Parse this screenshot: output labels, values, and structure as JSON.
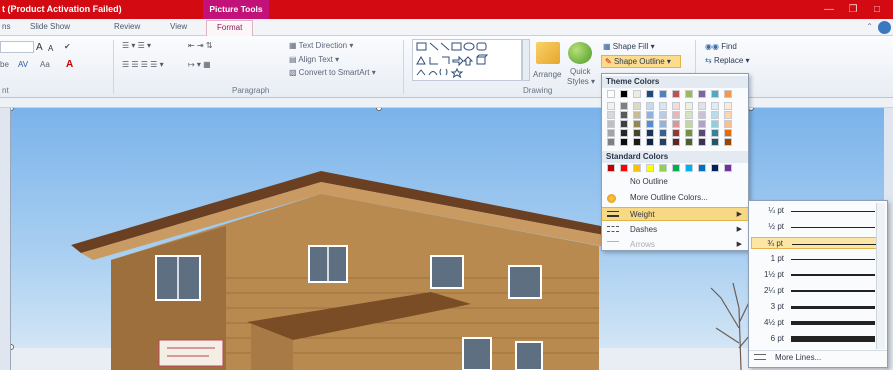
{
  "window": {
    "title": "t (Product Activation Failed)",
    "contextual_tab_group": "Picture Tools",
    "minimize_icon": "minimize-icon",
    "restore_icon": "restore-icon"
  },
  "tabs": [
    {
      "label": "ns"
    },
    {
      "label": "Slide Show"
    },
    {
      "label": "Review"
    },
    {
      "label": "View"
    },
    {
      "label": "Format"
    }
  ],
  "ribbon": {
    "font": {
      "label": "nt",
      "size_prefix": "be",
      "grow_icon": "A",
      "shrink_icon": "A",
      "clear_icon": "A",
      "char_spacing": "AV",
      "change_case": "Aa",
      "font_color": "A"
    },
    "paragraph": {
      "label": "Paragraph",
      "text_direction": "Text Direction",
      "align_text": "Align Text",
      "convert_smartart": "Convert to SmartArt"
    },
    "drawing": {
      "label": "Drawing",
      "arrange": "Arrange",
      "quick_styles_line1": "Quick",
      "quick_styles_line2": "Styles",
      "shape_fill": "Shape Fill",
      "shape_outline": "Shape Outline"
    },
    "editing": {
      "find": "Find",
      "replace": "Replace"
    }
  },
  "outline_menu": {
    "theme_colors_header": "Theme Colors",
    "standard_colors_header": "Standard Colors",
    "theme_top_row": [
      "#ffffff",
      "#000000",
      "#eeece1",
      "#1f497d",
      "#4f81bd",
      "#c0504d",
      "#9bbb59",
      "#8064a2",
      "#4bacc6",
      "#f79646"
    ],
    "theme_shades": [
      [
        "#f2f2f2",
        "#7f7f7f",
        "#ddd9c3",
        "#c6d9f0",
        "#dbe5f1",
        "#f2dcdb",
        "#ebf1dd",
        "#e5e0ec",
        "#dbeef3",
        "#fdeada"
      ],
      [
        "#d8d8d8",
        "#595959",
        "#c4bd97",
        "#8db3e2",
        "#b8cce4",
        "#e5b9b7",
        "#d7e3bc",
        "#ccc1d9",
        "#b7dde8",
        "#fbd5b5"
      ],
      [
        "#bfbfbf",
        "#3f3f3f",
        "#938953",
        "#548dd4",
        "#95b3d7",
        "#d99694",
        "#c3d69b",
        "#b2a2c7",
        "#92cddc",
        "#fac08f"
      ],
      [
        "#a5a5a5",
        "#262626",
        "#494429",
        "#17365d",
        "#366092",
        "#953734",
        "#76923c",
        "#5f497a",
        "#31859b",
        "#e36c09"
      ],
      [
        "#7f7f7f",
        "#0c0c0c",
        "#1d1b10",
        "#0f243e",
        "#244061",
        "#632423",
        "#4f6128",
        "#3f3151",
        "#205867",
        "#974806"
      ]
    ],
    "standard_colors": [
      "#c00000",
      "#ff0000",
      "#ffc000",
      "#ffff00",
      "#92d050",
      "#00b050",
      "#00b0f0",
      "#0070c0",
      "#002060",
      "#7030a0"
    ],
    "items": {
      "no_outline": "No Outline",
      "more_colors": "More Outline Colors...",
      "weight": "Weight",
      "dashes": "Dashes",
      "arrows": "Arrows"
    }
  },
  "weight_menu": {
    "options": [
      {
        "label": "¼ pt",
        "thickness": 1
      },
      {
        "label": "½ pt",
        "thickness": 1
      },
      {
        "label": "¾ pt",
        "thickness": 1,
        "selected": true
      },
      {
        "label": "1 pt",
        "thickness": 1
      },
      {
        "label": "1½ pt",
        "thickness": 2
      },
      {
        "label": "2¼ pt",
        "thickness": 2
      },
      {
        "label": "3 pt",
        "thickness": 3
      },
      {
        "label": "4½ pt",
        "thickness": 4
      },
      {
        "label": "6 pt",
        "thickness": 6
      }
    ],
    "more_lines": "More Lines..."
  },
  "colors": {
    "title_bar": "#d40a12",
    "contextual_tab": "#c2127a",
    "menu_highlight": "#f7d885",
    "sky": "#7ab3ea",
    "wood": "#b88a4f"
  }
}
